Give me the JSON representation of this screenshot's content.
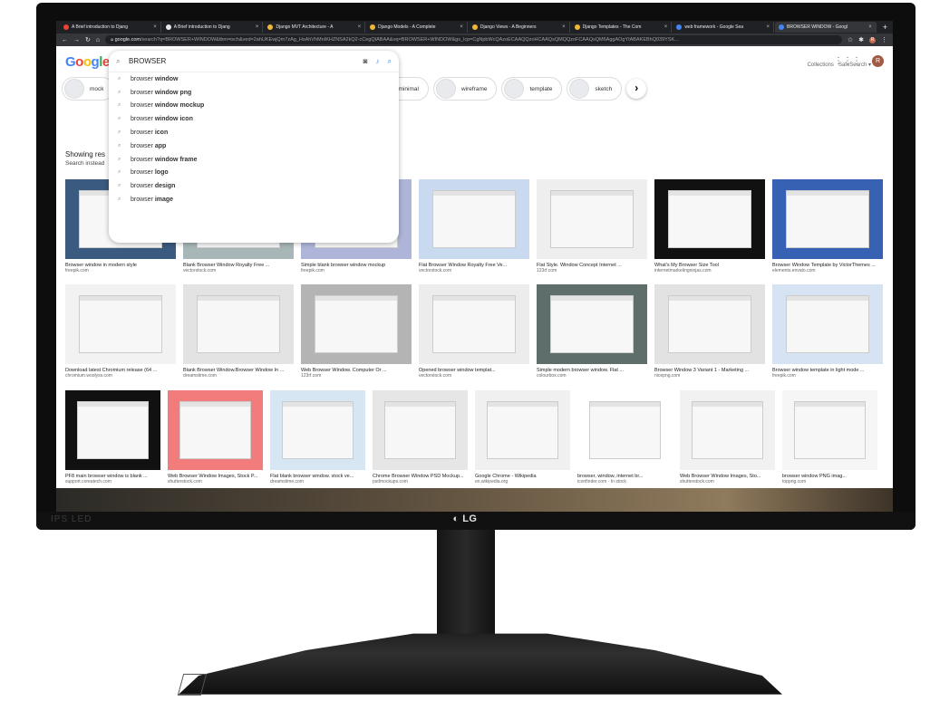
{
  "monitor": {
    "brand": "LG",
    "badge": "IPS LED"
  },
  "browser": {
    "tabs": [
      {
        "label": "A Brief introduction to Djang",
        "favicon_color": "#ea4335"
      },
      {
        "label": "A Brief introduction to Djang",
        "favicon_color": "#e8eaed"
      },
      {
        "label": "Django MVT Architecture - A",
        "favicon_color": "#f2b635"
      },
      {
        "label": "Django Models - A Complete",
        "favicon_color": "#f2b635"
      },
      {
        "label": "Django Views - A Beginners",
        "favicon_color": "#f2b635"
      },
      {
        "label": "Django Templates - The Com",
        "favicon_color": "#f2b635"
      },
      {
        "label": "web framework - Google Sea",
        "favicon_color": "#4285f4"
      },
      {
        "label": "BROWSER WINDOW - Googl",
        "favicon_color": "#4285f4"
      }
    ],
    "new_tab": "+",
    "url_domain": "google.com",
    "url_rest": "/search?q=BROWSER+WINDOW&tbm=isch&ved=2ahUKEwjQm7zAg_HsAhVhMnIKHZNSA2kQ2-cCegQIABAA&oq=BROWSER+WINDOW&gs_lcp=CgNpbWcQAzoECAAQQzoHCAAQsQMQQzoFCAAQsQM6AggAOgYIABAKEBhQ039YSK..."
  },
  "google": {
    "logo": "Google",
    "search_value": "BROWSER",
    "suggestions": [
      {
        "base": "browser ",
        "bold": "window"
      },
      {
        "base": "browser ",
        "bold": "window png"
      },
      {
        "base": "browser ",
        "bold": "window mockup"
      },
      {
        "base": "browser ",
        "bold": "window icon"
      },
      {
        "base": "browser ",
        "bold": "icon"
      },
      {
        "base": "browser ",
        "bold": "app"
      },
      {
        "base": "browser ",
        "bold": "window frame"
      },
      {
        "base": "browser ",
        "bold": "logo"
      },
      {
        "base": "browser ",
        "bold": "design"
      },
      {
        "base": "browser ",
        "bold": "image"
      }
    ],
    "avatar_letter": "R",
    "collections": "Collections",
    "safesearch": "SafeSearch ▾",
    "chips": [
      "mock",
      "parent",
      "safari",
      "simple",
      "web browser",
      "minimal",
      "wireframe",
      "template",
      "sketch"
    ],
    "showing": "Showing res",
    "search_instead": "Search instead",
    "results": [
      [
        {
          "caption": "Browser window in modern style",
          "source": "freepik.com",
          "bg": "#3a5a80"
        },
        {
          "caption": "Blank Browser Window Royalty Free ...",
          "source": "vectorstock.com",
          "bg": "#a7b6b7"
        },
        {
          "caption": "Simple blank browser window mockup",
          "source": "freepik.com",
          "bg": "#aeb5d8"
        },
        {
          "caption": "Flat Browser Window Royalty Free Ve...",
          "source": "vectorstock.com",
          "bg": "#c9d9ef"
        },
        {
          "caption": "Flat Style. Window Concept Internet ...",
          "source": "123rf.com",
          "bg": "#eeeeee"
        },
        {
          "caption": "What's My Browser Size Tool",
          "source": "internetmarketingninjas.com",
          "bg": "#111111"
        },
        {
          "caption": "Browser Window Template by VictorThemes ...",
          "source": "elements.envato.com",
          "bg": "#3762b4"
        }
      ],
      [
        {
          "caption": "Download latest Chromium release (64 ...",
          "source": "chromium.woolyss.com",
          "bg": "#f2f2f2"
        },
        {
          "caption": "Blank Browser Window.Browser Window In ...",
          "source": "dreamstime.com",
          "bg": "#e3e3e3"
        },
        {
          "caption": "Web Browser Window. Computer Or ...",
          "source": "123rf.com",
          "bg": "#b4b4b4"
        },
        {
          "caption": "Opened browser window templat...",
          "source": "vectorstock.com",
          "bg": "#ececec"
        },
        {
          "caption": "Simple modern browser window. Flat ...",
          "source": "colourbox.com",
          "bg": "#5d6e6b"
        },
        {
          "caption": "Browser Window 3 Variant 1 - Marketing ...",
          "source": "nicepng.com",
          "bg": "#e2e2e2"
        },
        {
          "caption": "Browser window template in light mode ...",
          "source": "freepik.com",
          "bg": "#d6e3f3"
        }
      ],
      [
        {
          "caption": "PF8 main browser window is blank ...",
          "source": "support.coreatech.com",
          "bg": "#111111"
        },
        {
          "caption": "Web Browser Window Images, Stock P...",
          "source": "shutterstock.com",
          "bg": "#f27c7c"
        },
        {
          "caption": "Flat blank browser window. stock ve...",
          "source": "dreamstime.com",
          "bg": "#d7e6f3"
        },
        {
          "caption": "Chrome Browser Window PSD Mockup...",
          "source": "psdmockups.com",
          "bg": "#e6e6e6"
        },
        {
          "caption": "Google Chrome - Wikipedia",
          "source": "en.wikipedia.org",
          "bg": "#f0f0f0"
        },
        {
          "caption": "browser, window, internet br...",
          "source": "iconfinder.com · In stock",
          "bg": "#ffffff"
        },
        {
          "caption": "Web Browser Window Images, Sto...",
          "source": "shutterstock.com",
          "bg": "#f1f1f1"
        },
        {
          "caption": "browser window PNG imag...",
          "source": "toppng.com",
          "bg": "#f6f6f6"
        }
      ]
    ]
  }
}
